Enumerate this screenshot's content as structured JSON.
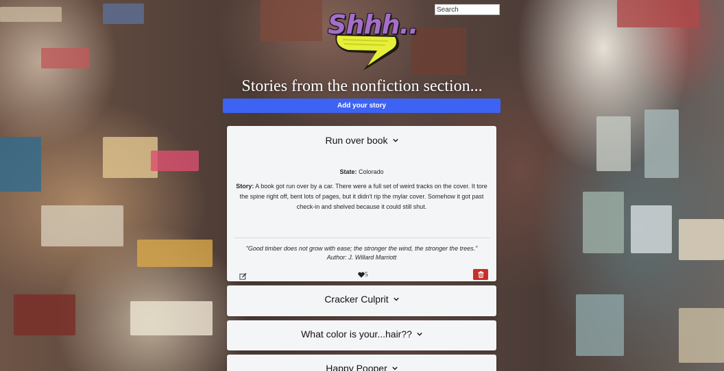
{
  "app": {
    "logo_text": "Shhh..",
    "search_placeholder": "Search",
    "headline": "Stories from the nonfiction section...",
    "add_story_label": "Add your story"
  },
  "stories": [
    {
      "title": "Run over book",
      "expanded": true,
      "state_label": "State:",
      "state": "Colorado",
      "story_label": "Story:",
      "story": "A book got run over by a car. There were a full set of weird tracks on the cover. It tore the spine right off, bent lots of pages, but it didn't rip the mylar cover. Somehow it got past check-in and shelved because it could still shut.",
      "quote": "\"Good timber does not grow with ease; the stronger the wind, the stronger the trees.\"",
      "quote_author": "Author: J. Willard Marriott",
      "likes": "5"
    },
    {
      "title": "Cracker Culprit",
      "expanded": false
    },
    {
      "title": "What color is your...hair??",
      "expanded": false
    },
    {
      "title": "Happy Pooper",
      "expanded": false
    }
  ],
  "colors": {
    "primary_button": "#3d63f5",
    "delete_button": "#c62f2b",
    "card_bg": "#f4f5f7"
  },
  "icons": {
    "expand": "chevron-down-icon",
    "edit": "edit-icon",
    "like": "heart-icon",
    "delete": "trash-icon"
  }
}
